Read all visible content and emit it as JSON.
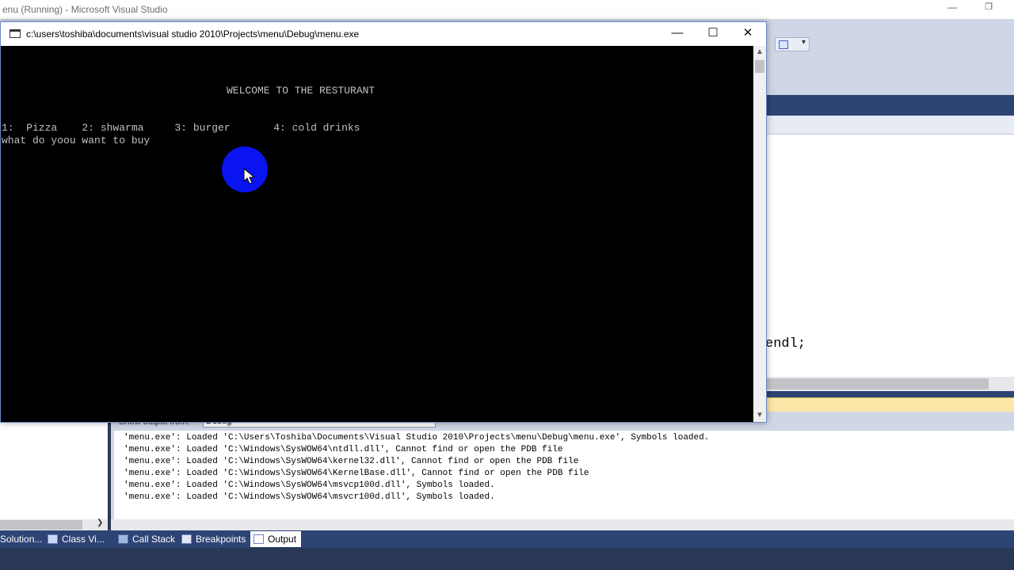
{
  "vs": {
    "title": "enu (Running) - Microsoft Visual Studio",
    "code_fragment": "endl;",
    "output": {
      "show_label": "Show output from:",
      "show_value": "Debug",
      "lines": [
        "'menu.exe': Loaded 'C:\\Users\\Toshiba\\Documents\\Visual Studio 2010\\Projects\\menu\\Debug\\menu.exe', Symbols loaded.",
        "'menu.exe': Loaded 'C:\\Windows\\SysWOW64\\ntdll.dll', Cannot find or open the PDB file",
        "'menu.exe': Loaded 'C:\\Windows\\SysWOW64\\kernel32.dll', Cannot find or open the PDB file",
        "'menu.exe': Loaded 'C:\\Windows\\SysWOW64\\KernelBase.dll', Cannot find or open the PDB file",
        "'menu.exe': Loaded 'C:\\Windows\\SysWOW64\\msvcp100d.dll', Symbols loaded.",
        "'menu.exe': Loaded 'C:\\Windows\\SysWOW64\\msvcr100d.dll', Symbols loaded."
      ]
    },
    "bottom_tabs": [
      {
        "label": "Solution...",
        "icon": "solution-explorer-icon"
      },
      {
        "label": "Class Vi...",
        "icon": "class-view-icon"
      },
      {
        "label": "Call Stack",
        "icon": "call-stack-icon"
      },
      {
        "label": "Breakpoints",
        "icon": "breakpoints-icon"
      },
      {
        "label": "Output",
        "icon": "output-icon",
        "active": true
      }
    ]
  },
  "console": {
    "title": "c:\\users\\toshiba\\documents\\visual studio 2010\\Projects\\menu\\Debug\\menu.exe",
    "controls": {
      "minimize": "—",
      "maximize": "☐",
      "close": "✕"
    },
    "lines": {
      "welcome": "WELCOME TO THE RESTURANT",
      "menu": "1:  Pizza    2: shwarma     3: burger       4: cold drinks",
      "prompt": "what do yoou want to buy"
    },
    "colors": {
      "text": "#c0c0c0",
      "background": "#000000",
      "cursor_highlight": "#0a14f0"
    }
  }
}
